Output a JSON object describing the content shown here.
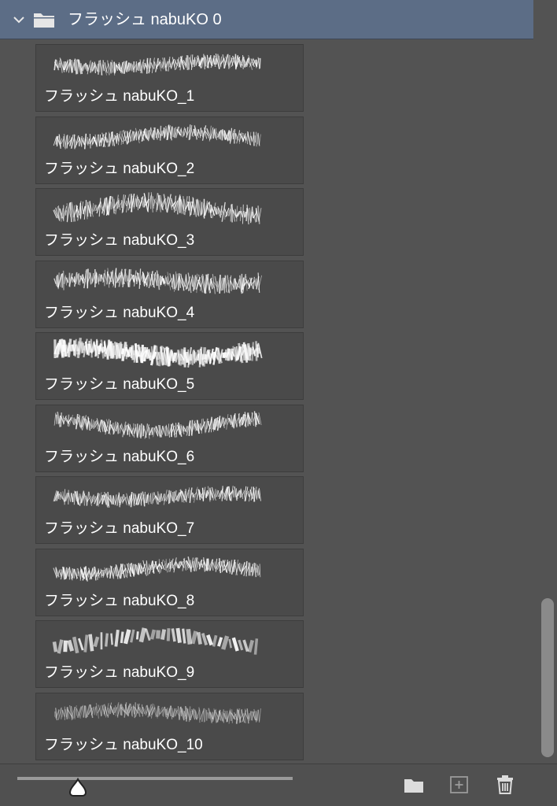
{
  "group": {
    "title": "フラッシュ nabuKO 0",
    "icons": [
      "chevron-down-icon",
      "folder-icon"
    ],
    "expanded": true,
    "selected": true
  },
  "presets": [
    {
      "name": "フラッシュ nabuKO_1"
    },
    {
      "name": "フラッシュ nabuKO_2"
    },
    {
      "name": "フラッシュ nabuKO_3"
    },
    {
      "name": "フラッシュ nabuKO_4"
    },
    {
      "name": "フラッシュ nabuKO_5"
    },
    {
      "name": "フラッシュ nabuKO_6"
    },
    {
      "name": "フラッシュ nabuKO_7"
    },
    {
      "name": "フラッシュ nabuKO_8"
    },
    {
      "name": "フラッシュ nabuKO_9"
    },
    {
      "name": "フラッシュ nabuKO_10"
    }
  ],
  "footer": {
    "size_slider_level": 0.22,
    "icons": [
      "new-group-folder-icon",
      "new-preset-icon",
      "trash-icon"
    ]
  },
  "colors": {
    "panel_bg": "#535353",
    "header_bg": "#5c6d86",
    "tile_bg": "#4a4a4a"
  }
}
